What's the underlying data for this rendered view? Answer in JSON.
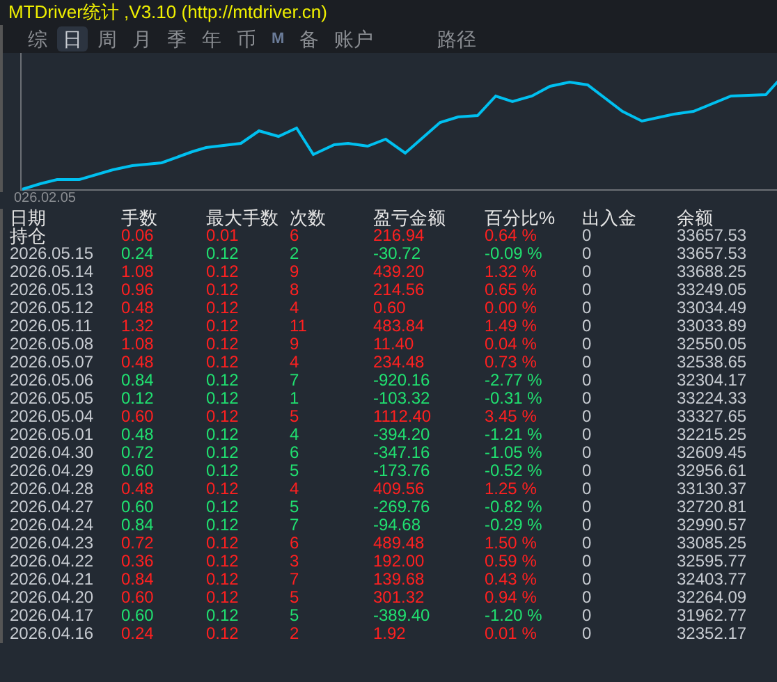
{
  "window": {
    "title": "MTDriver统计 ,V3.10 (http://mtdriver.cn)"
  },
  "tabs": [
    {
      "label": "综",
      "selected": false
    },
    {
      "label": "日",
      "selected": true
    },
    {
      "label": "周",
      "selected": false
    },
    {
      "label": "月",
      "selected": false
    },
    {
      "label": "季",
      "selected": false
    },
    {
      "label": "年",
      "selected": false
    },
    {
      "label": "币",
      "selected": false
    },
    {
      "label": "M",
      "selected": false
    },
    {
      "label": "备",
      "selected": false
    },
    {
      "label": "账户",
      "selected": false
    }
  ],
  "path_tab": {
    "label": "路径",
    "selected": false
  },
  "chart": {
    "start_label": "026.02.05"
  },
  "table": {
    "columns": [
      "日期",
      "手数",
      "最大手数",
      "次数",
      "盈亏金额",
      "百分比%",
      "出入金",
      "余额"
    ],
    "rows": [
      {
        "kind": "profit",
        "cells": [
          "持仓",
          "0.06",
          "0.01",
          "6",
          "216.94",
          "0.64 %",
          "0",
          "33657.53"
        ]
      },
      {
        "kind": "loss",
        "cells": [
          "2026.05.15",
          "0.24",
          "0.12",
          "2",
          "-30.72",
          "-0.09 %",
          "0",
          "33657.53"
        ]
      },
      {
        "kind": "profit",
        "cells": [
          "2026.05.14",
          "1.08",
          "0.12",
          "9",
          "439.20",
          "1.32 %",
          "0",
          "33688.25"
        ]
      },
      {
        "kind": "profit",
        "cells": [
          "2026.05.13",
          "0.96",
          "0.12",
          "8",
          "214.56",
          "0.65 %",
          "0",
          "33249.05"
        ]
      },
      {
        "kind": "profit",
        "cells": [
          "2026.05.12",
          "0.48",
          "0.12",
          "4",
          "0.60",
          "0.00 %",
          "0",
          "33034.49"
        ]
      },
      {
        "kind": "profit",
        "cells": [
          "2026.05.11",
          "1.32",
          "0.12",
          "11",
          "483.84",
          "1.49 %",
          "0",
          "33033.89"
        ]
      },
      {
        "kind": "profit",
        "cells": [
          "2026.05.08",
          "1.08",
          "0.12",
          "9",
          "11.40",
          "0.04 %",
          "0",
          "32550.05"
        ]
      },
      {
        "kind": "profit",
        "cells": [
          "2026.05.07",
          "0.48",
          "0.12",
          "4",
          "234.48",
          "0.73 %",
          "0",
          "32538.65"
        ]
      },
      {
        "kind": "loss",
        "cells": [
          "2026.05.06",
          "0.84",
          "0.12",
          "7",
          "-920.16",
          "-2.77 %",
          "0",
          "32304.17"
        ]
      },
      {
        "kind": "loss",
        "cells": [
          "2026.05.05",
          "0.12",
          "0.12",
          "1",
          "-103.32",
          "-0.31 %",
          "0",
          "33224.33"
        ]
      },
      {
        "kind": "profit",
        "cells": [
          "2026.05.04",
          "0.60",
          "0.12",
          "5",
          "1112.40",
          "3.45 %",
          "0",
          "33327.65"
        ]
      },
      {
        "kind": "loss",
        "cells": [
          "2026.05.01",
          "0.48",
          "0.12",
          "4",
          "-394.20",
          "-1.21 %",
          "0",
          "32215.25"
        ]
      },
      {
        "kind": "loss",
        "cells": [
          "2026.04.30",
          "0.72",
          "0.12",
          "6",
          "-347.16",
          "-1.05 %",
          "0",
          "32609.45"
        ]
      },
      {
        "kind": "loss",
        "cells": [
          "2026.04.29",
          "0.60",
          "0.12",
          "5",
          "-173.76",
          "-0.52 %",
          "0",
          "32956.61"
        ]
      },
      {
        "kind": "profit",
        "cells": [
          "2026.04.28",
          "0.48",
          "0.12",
          "4",
          "409.56",
          "1.25 %",
          "0",
          "33130.37"
        ]
      },
      {
        "kind": "loss",
        "cells": [
          "2026.04.27",
          "0.60",
          "0.12",
          "5",
          "-269.76",
          "-0.82 %",
          "0",
          "32720.81"
        ]
      },
      {
        "kind": "loss",
        "cells": [
          "2026.04.24",
          "0.84",
          "0.12",
          "7",
          "-94.68",
          "-0.29 %",
          "0",
          "32990.57"
        ]
      },
      {
        "kind": "profit",
        "cells": [
          "2026.04.23",
          "0.72",
          "0.12",
          "6",
          "489.48",
          "1.50 %",
          "0",
          "33085.25"
        ]
      },
      {
        "kind": "profit",
        "cells": [
          "2026.04.22",
          "0.36",
          "0.12",
          "3",
          "192.00",
          "0.59 %",
          "0",
          "32595.77"
        ]
      },
      {
        "kind": "profit",
        "cells": [
          "2026.04.21",
          "0.84",
          "0.12",
          "7",
          "139.68",
          "0.43 %",
          "0",
          "32403.77"
        ]
      },
      {
        "kind": "profit",
        "cells": [
          "2026.04.20",
          "0.60",
          "0.12",
          "5",
          "301.32",
          "0.94 %",
          "0",
          "32264.09"
        ]
      },
      {
        "kind": "loss",
        "cells": [
          "2026.04.17",
          "0.60",
          "0.12",
          "5",
          "-389.40",
          "-1.20 %",
          "0",
          "31962.77"
        ]
      },
      {
        "kind": "profit",
        "cells": [
          "2026.04.16",
          "0.24",
          "0.12",
          "2",
          "1.92",
          "0.01 %",
          "0",
          "32352.17"
        ]
      }
    ]
  }
}
